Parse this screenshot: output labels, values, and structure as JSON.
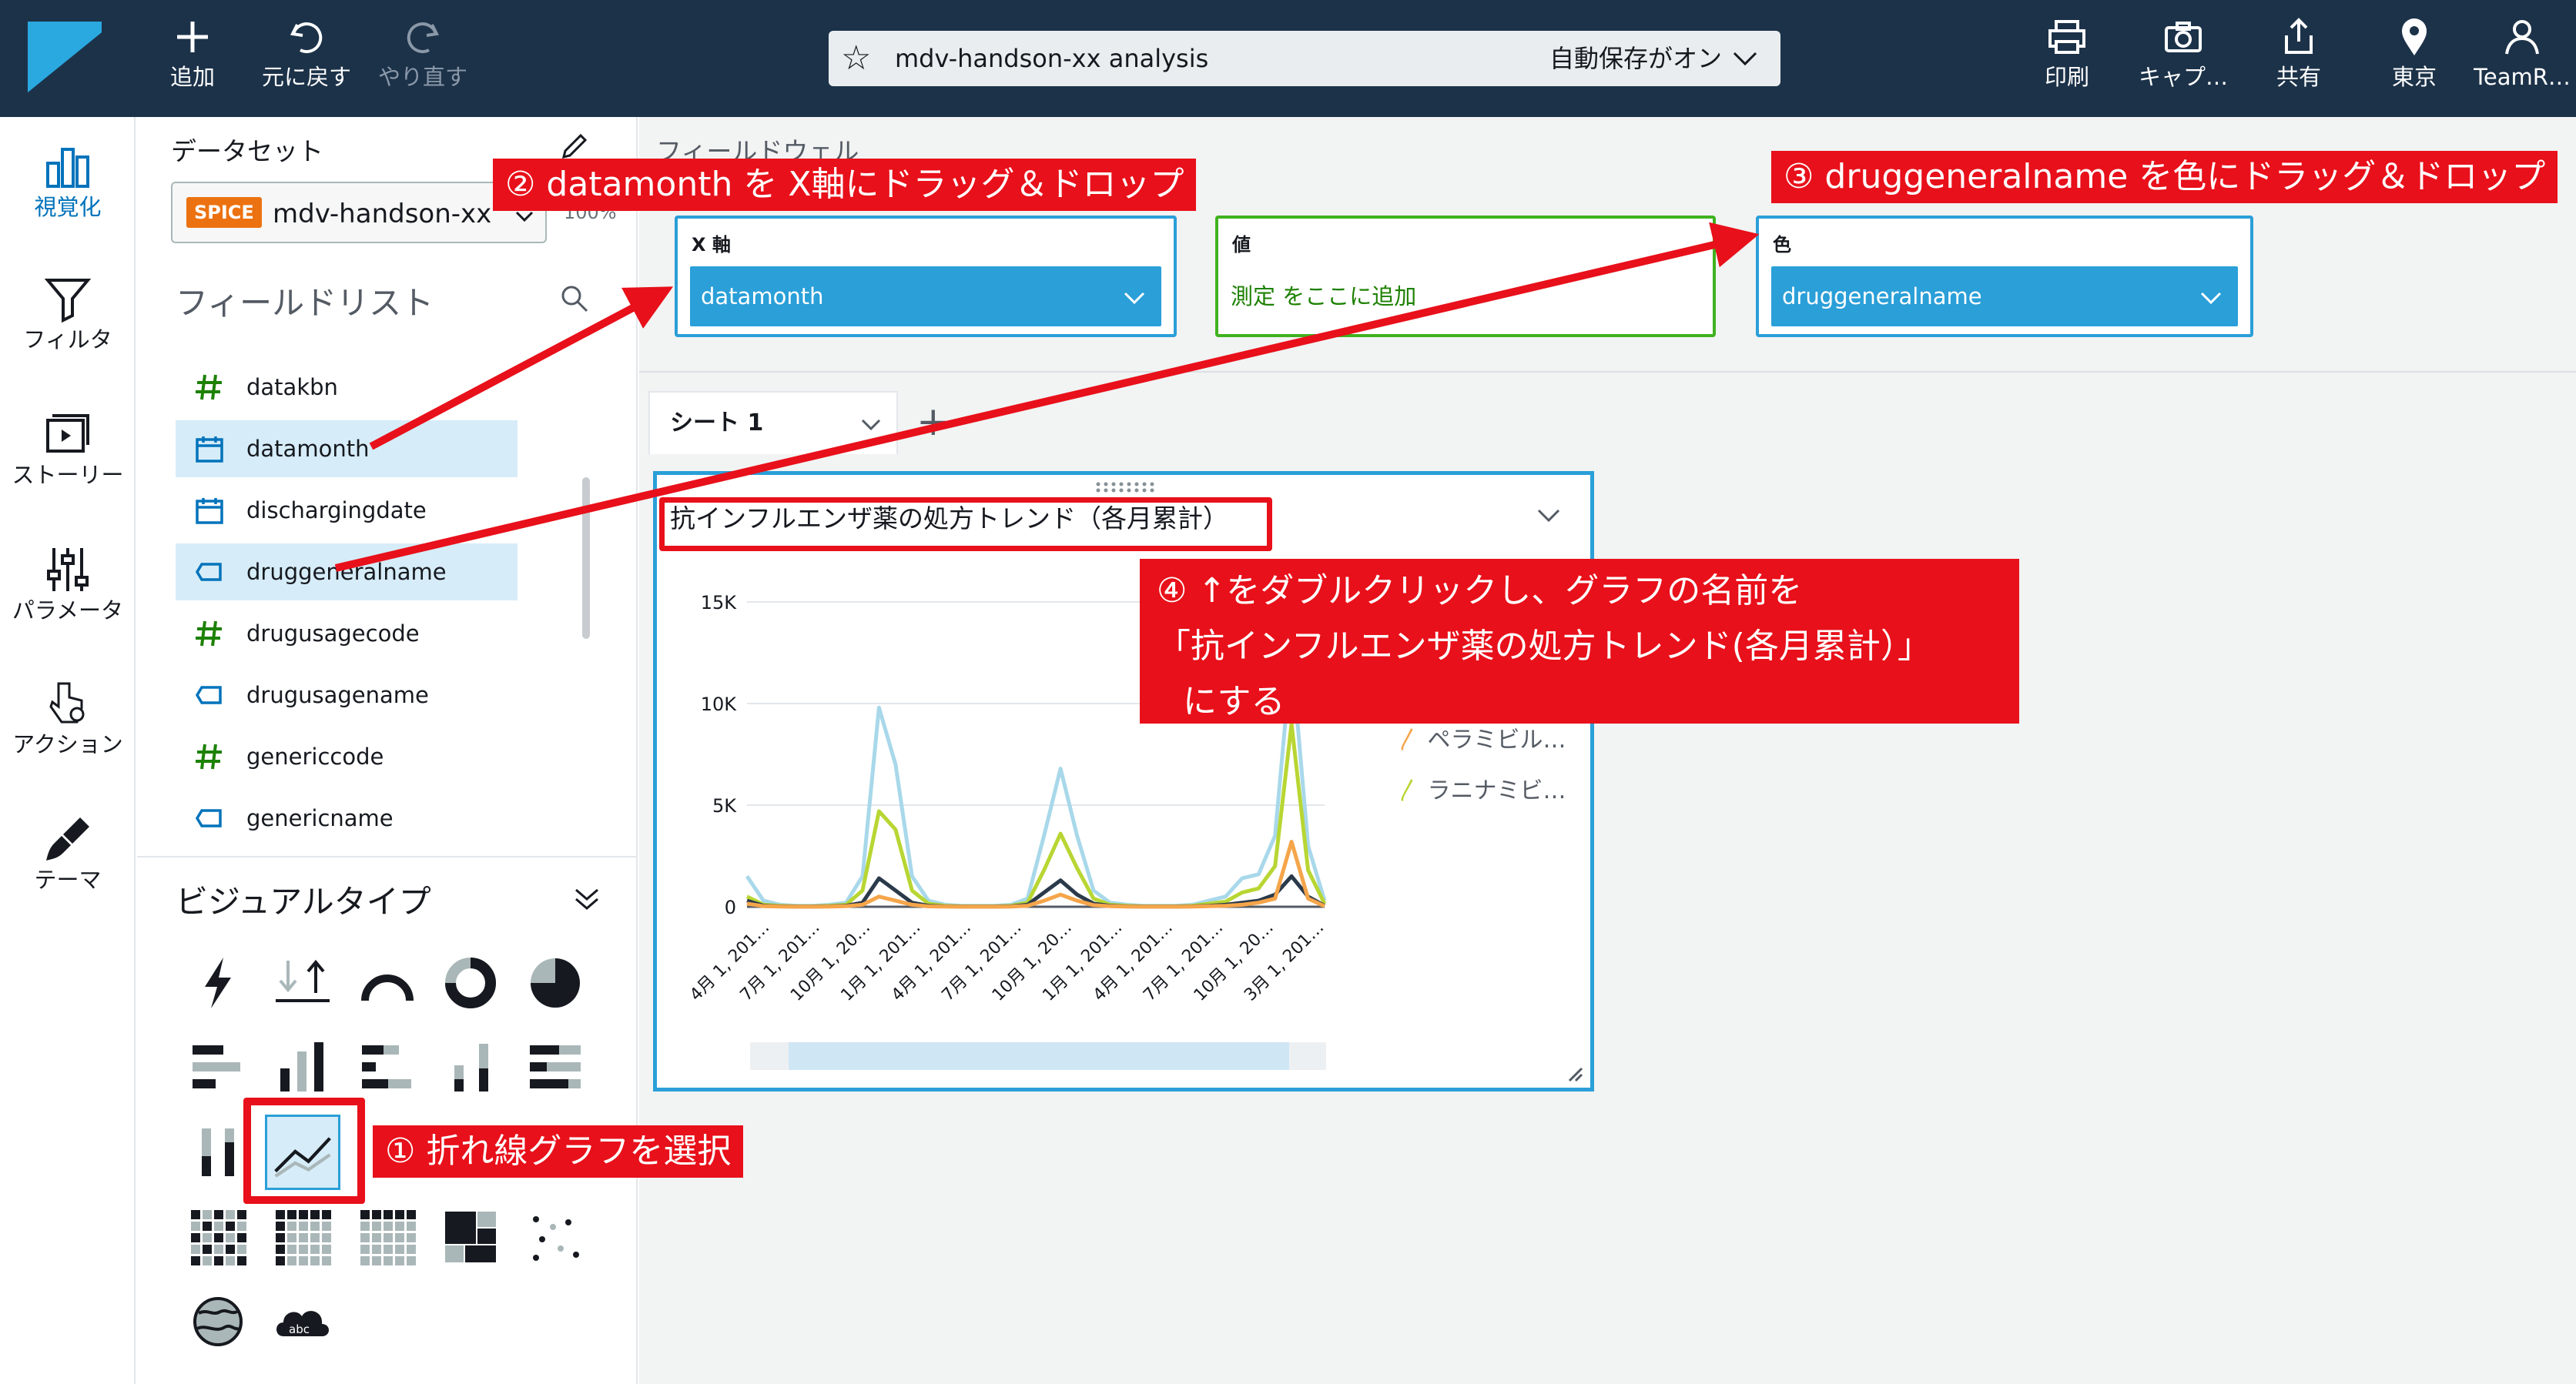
{
  "toolbar": {
    "add": "追加",
    "undo": "元に戻す",
    "redo": "やり直す",
    "analysis_title": "mdv-handson-xx analysis",
    "autosave": "自動保存がオン",
    "print": "印刷",
    "capture": "キャプ…",
    "share": "共有",
    "region": "東京",
    "user": "TeamR…"
  },
  "rail": {
    "items": [
      {
        "label": "視覚化",
        "icon": "visualize-icon"
      },
      {
        "label": "フィルタ",
        "icon": "filter-icon"
      },
      {
        "label": "ストーリー",
        "icon": "story-icon"
      },
      {
        "label": "パラメータ",
        "icon": "parameter-icon"
      },
      {
        "label": "アクション",
        "icon": "action-icon"
      },
      {
        "label": "テーマ",
        "icon": "theme-icon"
      }
    ]
  },
  "dataset": {
    "heading": "データセット",
    "badge": "SPICE",
    "name": "mdv-handson-xx",
    "percent": "100%"
  },
  "fieldlist": {
    "heading": "フィールドリスト",
    "fields": [
      {
        "name": "datakbn",
        "type": "numeric",
        "selected": false
      },
      {
        "name": "datamonth",
        "type": "date",
        "selected": true
      },
      {
        "name": "dischargingdate",
        "type": "date",
        "selected": false
      },
      {
        "name": "druggeneralname",
        "type": "dimension",
        "selected": true
      },
      {
        "name": "drugusagecode",
        "type": "numeric",
        "selected": false
      },
      {
        "name": "drugusagename",
        "type": "dimension",
        "selected": false
      },
      {
        "name": "genericcode",
        "type": "numeric",
        "selected": false
      },
      {
        "name": "genericname",
        "type": "dimension",
        "selected": false
      }
    ]
  },
  "visualtypes": {
    "heading": "ビジュアルタイプ"
  },
  "wells": {
    "heading": "フィールドウェル",
    "x_label": "X 軸",
    "x_value": "datamonth",
    "value_label": "値",
    "value_hint": "測定 をここに追加",
    "color_label": "色",
    "color_value": "druggeneralname"
  },
  "sheet": {
    "tab_label": "シート 1",
    "add": "+"
  },
  "visual": {
    "title": "抗インフルエンザ薬の処方トレンド（各月累計）",
    "legend": [
      "ペラミビル…",
      "ラニナミビ…"
    ]
  },
  "annotations": {
    "step1": "① 折れ線グラフを選択",
    "step2": "② datamonth を X軸にドラッグ＆ドロップ",
    "step3": "③ druggeneralname を色にドラッグ＆ドロップ",
    "step4_line1": "④ ↑をダブルクリックし、グラフの名前を",
    "step4_line2": "「抗インフルエンザ薬の処方トレンド(各月累計）」",
    "step4_line3": "にする"
  },
  "colors": {
    "topbar": "#1c3249",
    "accent": "#2a9fd8",
    "annotation": "#e8101a",
    "series_light_blue": "#a8d8ea",
    "series_yellow_green": "#b8d633",
    "series_dark": "#2b3a4a",
    "series_orange": "#f5a54a"
  },
  "chart_data": {
    "type": "line",
    "title": "抗インフルエンザ薬の処方トレンド（各月累計）",
    "xlabel": "",
    "ylabel": "",
    "ylim": [
      0,
      15000
    ],
    "y_ticks": [
      "15K",
      "10K",
      "5K",
      "0"
    ],
    "x_tick_labels": [
      "4月 1, 201…",
      "7月 1, 201…",
      "10月 1, 20…",
      "1月 1, 201…",
      "4月 1, 201…",
      "7月 1, 201…",
      "10月 1, 20…",
      "1月 1, 201…",
      "4月 1, 201…",
      "7月 1, 201…",
      "10月 1, 20…",
      "3月 1, 201…"
    ],
    "x_count": 36,
    "legend_position": "right",
    "series": [
      {
        "color": "#a8d8ea",
        "values": [
          1500,
          300,
          100,
          50,
          50,
          100,
          200,
          1500,
          9800,
          7000,
          1500,
          300,
          100,
          50,
          50,
          50,
          100,
          400,
          3500,
          6800,
          3500,
          800,
          200,
          100,
          50,
          50,
          50,
          100,
          300,
          500,
          1400,
          1600,
          3500,
          12500,
          3000,
          300
        ]
      },
      {
        "color": "#b8d633",
        "values": [
          500,
          100,
          50,
          20,
          20,
          50,
          100,
          800,
          4700,
          3800,
          800,
          150,
          50,
          20,
          20,
          20,
          50,
          200,
          1800,
          3600,
          1900,
          400,
          100,
          50,
          20,
          20,
          20,
          50,
          150,
          250,
          700,
          900,
          2000,
          9000,
          1800,
          150
        ]
      },
      {
        "color": "#2b3a4a",
        "values": [
          300,
          50,
          20,
          10,
          10,
          20,
          50,
          200,
          1400,
          800,
          200,
          50,
          20,
          10,
          10,
          10,
          20,
          100,
          700,
          1300,
          600,
          150,
          50,
          20,
          10,
          10,
          10,
          20,
          50,
          100,
          200,
          300,
          600,
          1500,
          500,
          50
        ]
      },
      {
        "color": "#f5a54a",
        "values": [
          150,
          30,
          10,
          5,
          5,
          10,
          30,
          100,
          500,
          300,
          100,
          20,
          10,
          5,
          5,
          5,
          10,
          50,
          300,
          600,
          300,
          80,
          30,
          10,
          5,
          5,
          5,
          10,
          30,
          50,
          100,
          200,
          400,
          3200,
          400,
          30
        ]
      }
    ]
  }
}
